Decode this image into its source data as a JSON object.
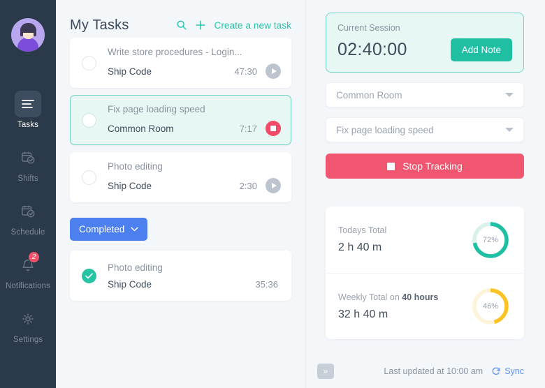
{
  "sidebar": {
    "avatar_name": "user-avatar",
    "items": [
      {
        "label": "Tasks",
        "icon": "list-icon",
        "active": true
      },
      {
        "label": "Shifts",
        "icon": "calendar-check-icon",
        "active": false
      },
      {
        "label": "Schedule",
        "icon": "calendar-clock-icon",
        "active": false
      },
      {
        "label": "Notifications",
        "icon": "bell-icon",
        "active": false,
        "badge": "2"
      },
      {
        "label": "Settings",
        "icon": "gear-icon",
        "active": false
      }
    ]
  },
  "tasks_panel": {
    "title": "My Tasks",
    "search_icon": "search-icon",
    "create_icon": "plus-icon",
    "create_label": "Create a new task",
    "tasks": [
      {
        "title": "Write store procedures - Login...",
        "project": "Ship Code",
        "time": "47:30",
        "state": "idle",
        "control": "play"
      },
      {
        "title": "Fix page loading speed",
        "project": "Common Room",
        "time": "7:17",
        "state": "tracking",
        "control": "stop"
      },
      {
        "title": "Photo editing",
        "project": "Ship Code",
        "time": "2:30",
        "state": "idle",
        "control": "play"
      }
    ],
    "completed_button": {
      "label": "Completed",
      "chevron_icon": "chevron-down-icon"
    },
    "completed_tasks": [
      {
        "title": "Photo editing",
        "project": "Ship Code",
        "time": "35:36",
        "state": "done",
        "control": "none"
      }
    ]
  },
  "right_panel": {
    "session": {
      "label": "Current Session",
      "time": "02:40:00",
      "add_note_label": "Add Note"
    },
    "room_select": {
      "value": "Common Room",
      "icon": "chevron-down-icon"
    },
    "task_select": {
      "value": "Fix page loading speed",
      "icon": "chevron-down-icon"
    },
    "stop_tracking_label": "Stop Tracking",
    "stop_tracking_icon": "stop-square-icon",
    "footer": {
      "collapse_icon": "»",
      "updated_text": "Last updated at 10:00 am",
      "sync_label": "Sync",
      "sync_icon": "refresh-icon"
    }
  },
  "chart_data": [
    {
      "type": "pie",
      "title": "Todays Total",
      "value_label": "2 h 40 m",
      "percent": 72,
      "percent_label": "72%",
      "color": "#1fbfa3",
      "track_color": "#d8f1ea"
    },
    {
      "type": "pie",
      "title_prefix": "Weekly Total on",
      "title_emphasis": "40 hours",
      "value_label": "32 h 40 m",
      "percent": 46,
      "percent_label": "46%",
      "color": "#fcc324",
      "track_color": "#fdf3d8"
    }
  ],
  "colors": {
    "sidebar_bg": "#2b3a4a",
    "accent_teal": "#20bfa4",
    "accent_red": "#f0566f",
    "accent_blue": "#4d80ef",
    "accent_yellow": "#fcc324",
    "page_bg": "#f4f7fa"
  }
}
